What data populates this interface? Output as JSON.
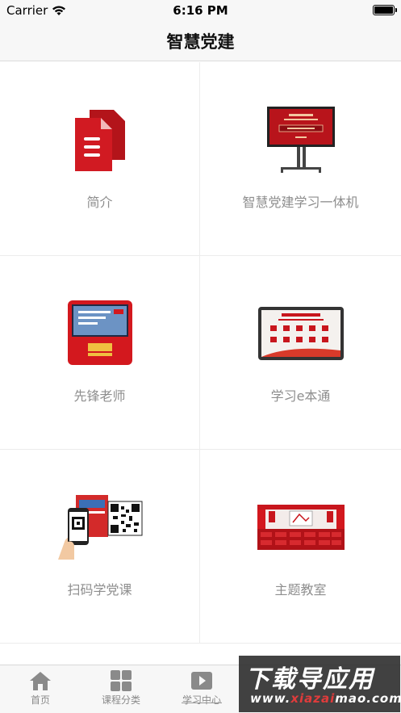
{
  "status_bar": {
    "carrier": "Carrier",
    "time": "6:16 PM",
    "wifi_icon": "wifi-icon",
    "battery_icon": "battery-full-icon"
  },
  "nav": {
    "title": "智慧党建"
  },
  "grid": [
    {
      "label": "简介",
      "icon": "document-icon"
    },
    {
      "label": "智慧党建学习一体机",
      "icon": "display-kiosk-image"
    },
    {
      "label": "先锋老师",
      "icon": "red-terminal-image"
    },
    {
      "label": "学习e本通",
      "icon": "tablet-image"
    },
    {
      "label": "扫码学党课",
      "icon": "qr-phone-image"
    },
    {
      "label": "主题教室",
      "icon": "classroom-image"
    }
  ],
  "tabs": [
    {
      "label": "首页",
      "icon": "home-icon"
    },
    {
      "label": "课程分类",
      "icon": "grid-icon"
    },
    {
      "label": "学习中心",
      "icon": "play-icon"
    }
  ],
  "watermark": {
    "top": "下载导应用",
    "bottom": "www.xiazaimao.com"
  },
  "colors": {
    "accent_red": "#c8161d",
    "bar_bg": "#f7f7f7",
    "label_gray": "#8e8e8e"
  }
}
